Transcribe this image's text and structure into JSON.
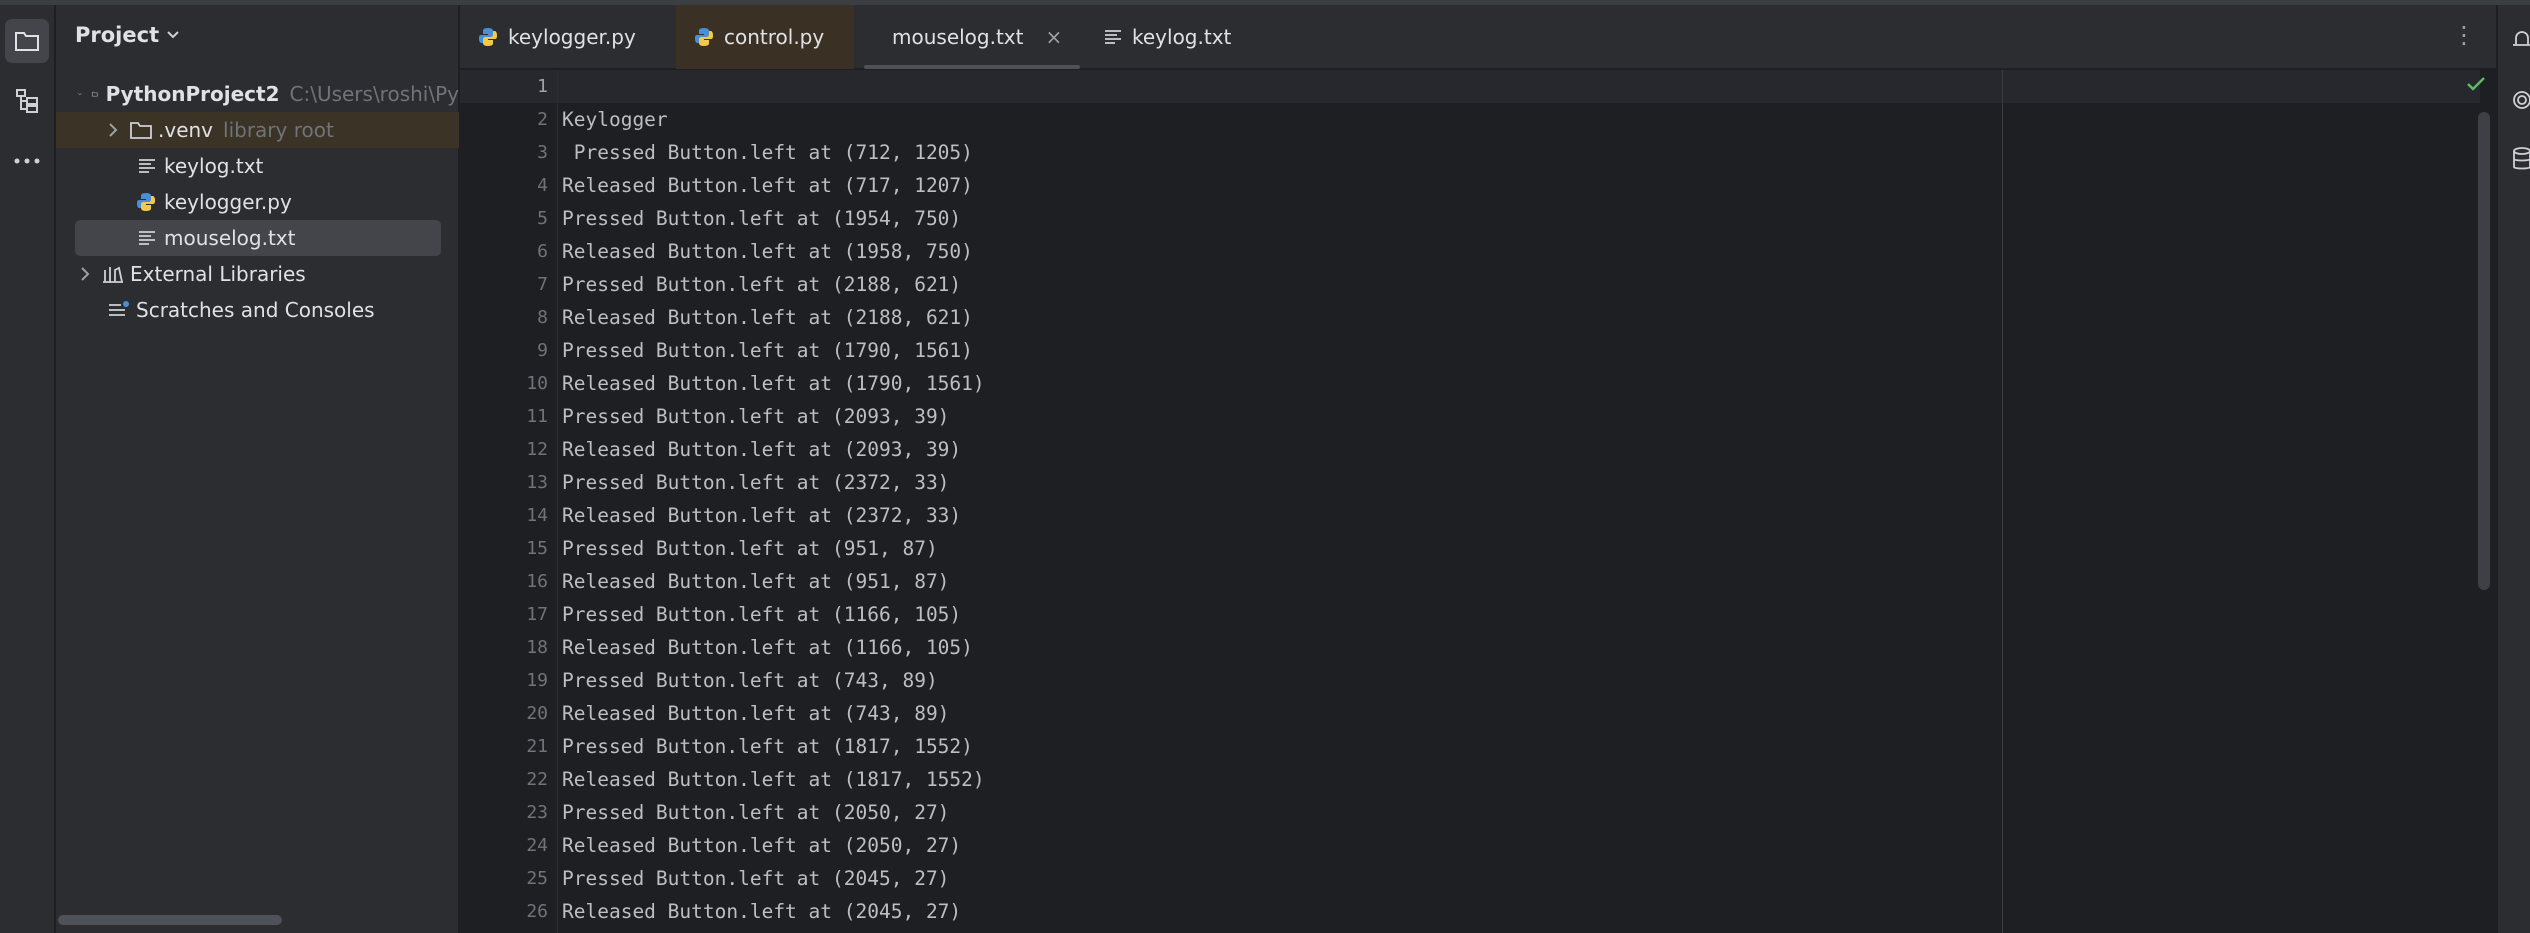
{
  "project_panel": {
    "title": "Project",
    "root": {
      "name": "PythonProject2",
      "path": "C:\\Users\\roshi\\Py"
    },
    "venv": {
      "name": ".venv",
      "hint": "library root"
    },
    "files": [
      "keylog.txt",
      "keylogger.py",
      "mouselog.txt"
    ],
    "external_libraries": "External Libraries",
    "scratches": "Scratches and Consoles"
  },
  "tabs": [
    {
      "label": "keylogger.py",
      "icon": "python-file-icon"
    },
    {
      "label": "control.py",
      "icon": "python-file-icon"
    },
    {
      "label": "mouselog.txt",
      "icon": "text-file-icon",
      "active": true
    },
    {
      "label": "keylog.txt",
      "icon": "text-file-icon"
    }
  ],
  "editor": {
    "line_numbers": [
      "1",
      "2",
      "3",
      "4",
      "5",
      "6",
      "7",
      "8",
      "9",
      "10",
      "11",
      "12",
      "13",
      "14",
      "15",
      "16",
      "17",
      "18",
      "19",
      "20",
      "21",
      "22",
      "23",
      "24",
      "25",
      "26"
    ],
    "lines": [
      "",
      "Keylogger",
      " Pressed Button.left at (712, 1205)",
      "Released Button.left at (717, 1207)",
      "Pressed Button.left at (1954, 750)",
      "Released Button.left at (1958, 750)",
      "Pressed Button.left at (2188, 621)",
      "Released Button.left at (2188, 621)",
      "Pressed Button.left at (1790, 1561)",
      "Released Button.left at (1790, 1561)",
      "Pressed Button.left at (2093, 39)",
      "Released Button.left at (2093, 39)",
      "Pressed Button.left at (2372, 33)",
      "Released Button.left at (2372, 33)",
      "Pressed Button.left at (951, 87)",
      "Released Button.left at (951, 87)",
      "Pressed Button.left at (1166, 105)",
      "Released Button.left at (1166, 105)",
      "Pressed Button.left at (743, 89)",
      "Released Button.left at (743, 89)",
      "Pressed Button.left at (1817, 1552)",
      "Released Button.left at (1817, 1552)",
      "Pressed Button.left at (2050, 27)",
      "Released Button.left at (2050, 27)",
      "Pressed Button.left at (2045, 27)",
      "Released Button.left at (2045, 27)"
    ]
  },
  "colors": {
    "background": "#1e1f22",
    "panel": "#2b2d30",
    "selection": "#43454a",
    "text": "#dfe1e5",
    "code_text": "#bcbec4",
    "line_number": "#6f737a",
    "inspection_ok": "#5fb865"
  }
}
